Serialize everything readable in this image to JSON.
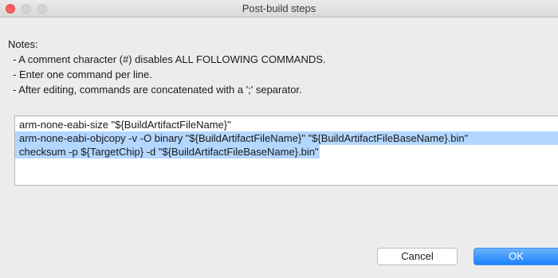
{
  "window": {
    "title": "Post-build steps"
  },
  "notes": {
    "heading": "Notes:",
    "items": [
      "- A comment character (#) disables ALL FOLLOWING COMMANDS.",
      "- Enter one command per line.",
      "- After editing, commands are concatenated with a ';' separator."
    ]
  },
  "editor": {
    "lines": [
      "arm-none-eabi-size \"${BuildArtifactFileName}\"",
      "arm-none-eabi-objcopy -v -O binary \"${BuildArtifactFileName}\" \"${BuildArtifactFileBaseName}.bin\"",
      "checksum -p ${TargetChip} -d \"${BuildArtifactFileBaseName}.bin\""
    ],
    "selection_color": "#b3d7ff"
  },
  "buttons": {
    "cancel": "Cancel",
    "ok": "OK"
  },
  "colors": {
    "accent": "#1a82fb",
    "close": "#fc605c"
  }
}
